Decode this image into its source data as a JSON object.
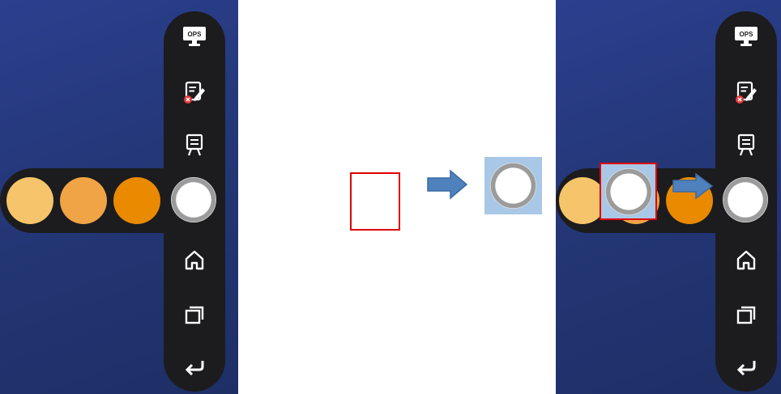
{
  "left_panel": {
    "toolbar": {
      "ops_label": "OPS",
      "buttons": [
        "ops-icon",
        "annotate-icon",
        "whiteboard-icon",
        "pen-button",
        "home-icon",
        "multitask-icon",
        "back-icon"
      ]
    },
    "color_dots": [
      "#f6c46a",
      "#f0a445",
      "#ea8a00"
    ]
  },
  "middle_panel": {
    "empty_box_color": "#e00000",
    "arrow_color": "#4f81bd",
    "zoom_bg": "#a9c7e6"
  },
  "right_panel": {
    "toolbar": {
      "ops_label": "OPS"
    },
    "color_dots": [
      "#f6c46a",
      "#f0a445",
      "#ea8a00"
    ],
    "highlight_color": "#e00000",
    "arrow_color": "#4f81bd"
  },
  "colors": {
    "background": "#243777",
    "toolbar": "#1c1c1e",
    "icon": "#ffffff"
  }
}
